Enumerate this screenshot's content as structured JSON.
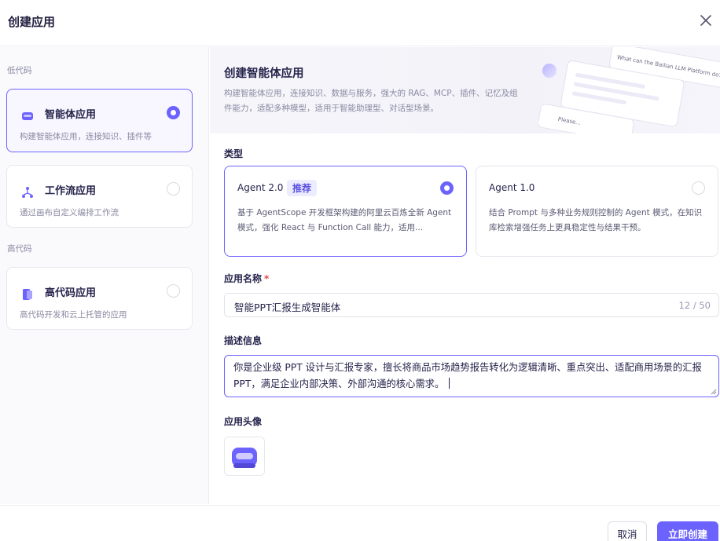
{
  "dialog": {
    "title": "创建应用",
    "close_icon": "close-icon"
  },
  "sidebar": {
    "low_code_label": "低代码",
    "high_code_label": "高代码",
    "apps": [
      {
        "title": "智能体应用",
        "desc": "构建智能体应用，连接知识、插件等",
        "icon": "agent-icon",
        "selected": true
      },
      {
        "title": "工作流应用",
        "desc": "通过画布自定义编排工作流",
        "icon": "workflow-icon",
        "selected": false
      },
      {
        "title": "高代码应用",
        "desc": "高代码开发和云上托管的应用",
        "icon": "code-icon",
        "selected": false
      }
    ]
  },
  "banner": {
    "title": "创建智能体应用",
    "desc": "构建智能体应用，连接知识、数据与服务，强大的 RAG、MCP、插件、记忆及组件能力，适配多种模型，适用于智能助理型、对话型场景。",
    "art_text_1": "What can the Bailian LLM Platform do?",
    "art_text_2": "Please..."
  },
  "form": {
    "type_label": "类型",
    "types": [
      {
        "name": "Agent 2.0",
        "badge": "推荐",
        "desc": "基于 AgentScope 开发框架构建的阿里云百炼全新 Agent 模式，强化 React 与 Function Call 能力，适用...",
        "selected": true
      },
      {
        "name": "Agent 1.0",
        "badge": "",
        "desc": "结合 Prompt 与多种业务规则控制的 Agent 模式，在知识库检索增强任务上更具稳定性与结果干预。",
        "selected": false
      }
    ],
    "name_label": "应用名称",
    "name_required": "*",
    "name_value": "智能PPT汇报生成智能体",
    "name_count": "12 / 50",
    "desc_label": "描述信息",
    "desc_value": "你是企业级 PPT 设计与汇报专家，擅长将商品市场趋势报告转化为逻辑清晰、重点突出、适配商用场景的汇报 PPT，满足企业内部决策、外部沟通的核心需求。",
    "avatar_label": "应用头像"
  },
  "footer": {
    "cancel_label": "取消",
    "create_label": "立即创建"
  },
  "colors": {
    "accent": "#6c63ff",
    "accent_soft": "#ecebff",
    "required": "#e5484d"
  }
}
